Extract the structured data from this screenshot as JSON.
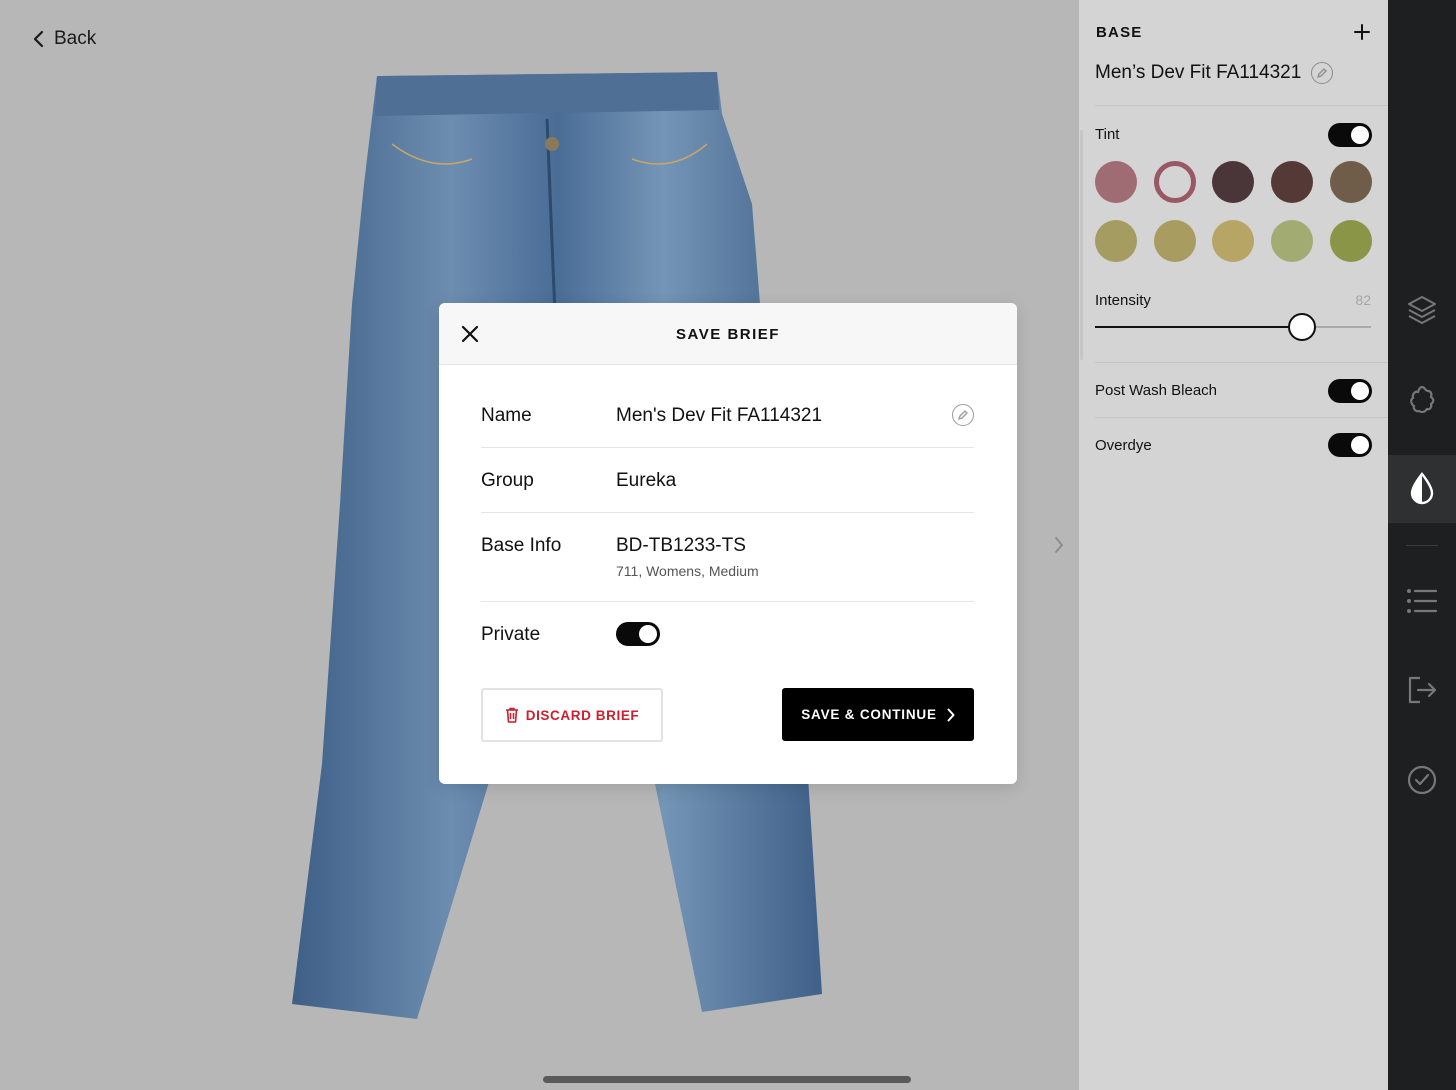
{
  "nav": {
    "back_label": "Back"
  },
  "panel": {
    "section_label": "BASE",
    "title": "Men’s Dev Fit FA114321",
    "tint_label": "Tint",
    "tint_enabled": true,
    "swatches": [
      "#a06c74",
      "#9a5865",
      "#4a3639",
      "#553937",
      "#6f5d49",
      "#a59c62",
      "#a99c60",
      "#b6a565",
      "#a2ac72",
      "#8b9548"
    ],
    "selected_swatch_index": 1,
    "intensity_label": "Intensity",
    "intensity_value": "82",
    "intensity_fraction": 0.75,
    "post_wash_bleach_label": "Post Wash Bleach",
    "post_wash_bleach_enabled": true,
    "overdye_label": "Overdye",
    "overdye_enabled": true
  },
  "rail": {
    "items": [
      "layers-icon",
      "wash-icon",
      "drop-icon",
      "list-icon",
      "export-icon",
      "check-circle-icon"
    ],
    "active": "drop-icon"
  },
  "dialog": {
    "title": "SAVE BRIEF",
    "name_label": "Name",
    "name_value": "Men's Dev Fit FA114321",
    "group_label": "Group",
    "group_value": "Eureka",
    "base_info_label": "Base Info",
    "base_info_value": "BD-TB1233-TS",
    "base_info_sub": "711, Womens, Medium",
    "private_label": "Private",
    "private_enabled": true,
    "discard_label": "DISCARD BRIEF",
    "save_label": "SAVE & CONTINUE"
  },
  "colors": {
    "accent_red": "#cc1f2f",
    "primary": "#000000"
  }
}
